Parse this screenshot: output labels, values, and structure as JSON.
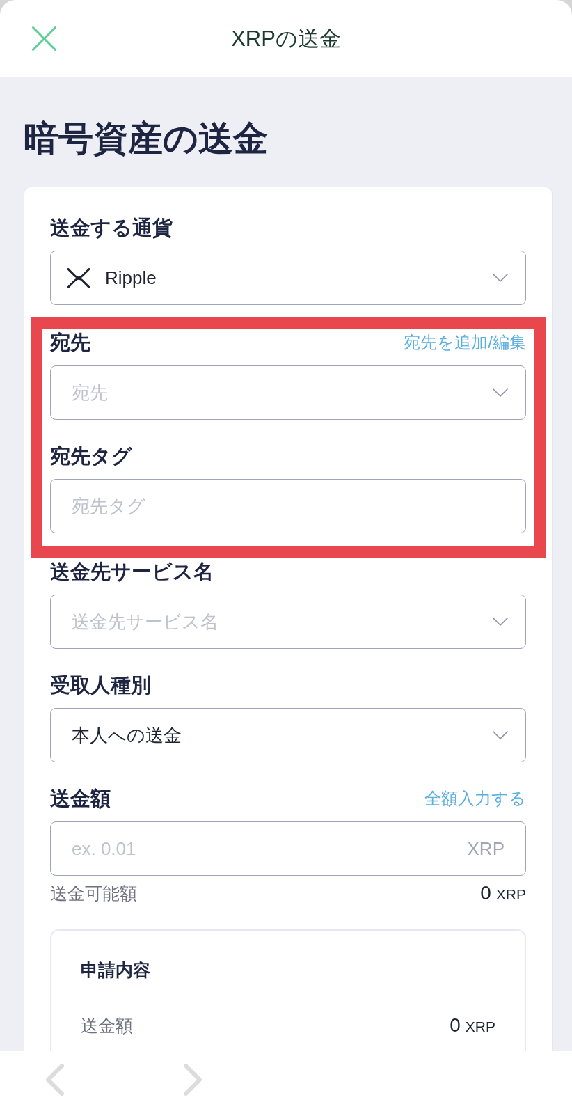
{
  "header": {
    "title": "XRPの送金"
  },
  "page_title": "暗号資産の送金",
  "fields": [
    {
      "kind": "currency",
      "label": "送金する通貨",
      "value": "Ripple",
      "highlighted": false
    },
    {
      "kind": "select",
      "label": "宛先",
      "link": "宛先を追加/編集",
      "placeholder": "宛先",
      "highlighted": true
    },
    {
      "kind": "input",
      "label": "宛先タグ",
      "placeholder": "宛先タグ",
      "highlighted": true
    },
    {
      "kind": "select",
      "label": "送金先サービス名",
      "placeholder": "送金先サービス名",
      "highlighted": false
    },
    {
      "kind": "select",
      "label": "受取人種別",
      "value": "本人への送金",
      "highlighted": false
    },
    {
      "kind": "amount",
      "label": "送金額",
      "link": "全額入力する",
      "placeholder": "ex. 0.01",
      "unit": "XRP",
      "highlighted": false,
      "available": {
        "label": "送金可能額",
        "value": "0",
        "unit": "XRP"
      }
    }
  ],
  "summary": {
    "title": "申請内容",
    "rows": [
      {
        "label": "送金額",
        "value": "0",
        "unit": "XRP"
      }
    ]
  },
  "toolbar": {
    "back": {
      "disabled": true
    },
    "forward": {
      "disabled": true
    }
  }
}
